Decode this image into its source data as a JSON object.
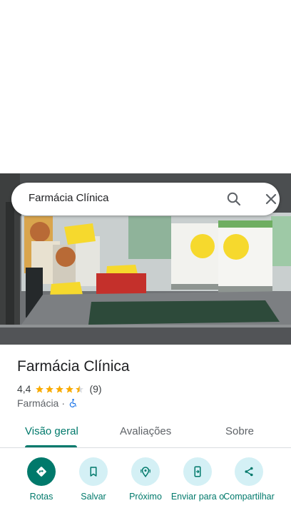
{
  "search": {
    "query": "Farmácia Clínica"
  },
  "place": {
    "title": "Farmácia Clínica",
    "rating": "4,4",
    "stars": 4.4,
    "review_count": "(9)",
    "category": "Farmácia",
    "separator": "·"
  },
  "tabs": [
    {
      "label": "Visão geral",
      "active": true
    },
    {
      "label": "Avaliações",
      "active": false
    },
    {
      "label": "Sobre",
      "active": false
    }
  ],
  "actions": [
    {
      "label": "Rotas",
      "icon": "directions-icon"
    },
    {
      "label": "Salvar",
      "icon": "bookmark-icon"
    },
    {
      "label": "Próximo",
      "icon": "nearby-icon"
    },
    {
      "label": "Enviar para o",
      "icon": "send-to-phone-icon"
    },
    {
      "label": "Compartilhar",
      "icon": "share-icon"
    }
  ],
  "colors": {
    "accent": "#00796b",
    "action_bg": "#d4f0f5",
    "star": "#f9ab00",
    "wheelchair": "#1a73e8"
  }
}
